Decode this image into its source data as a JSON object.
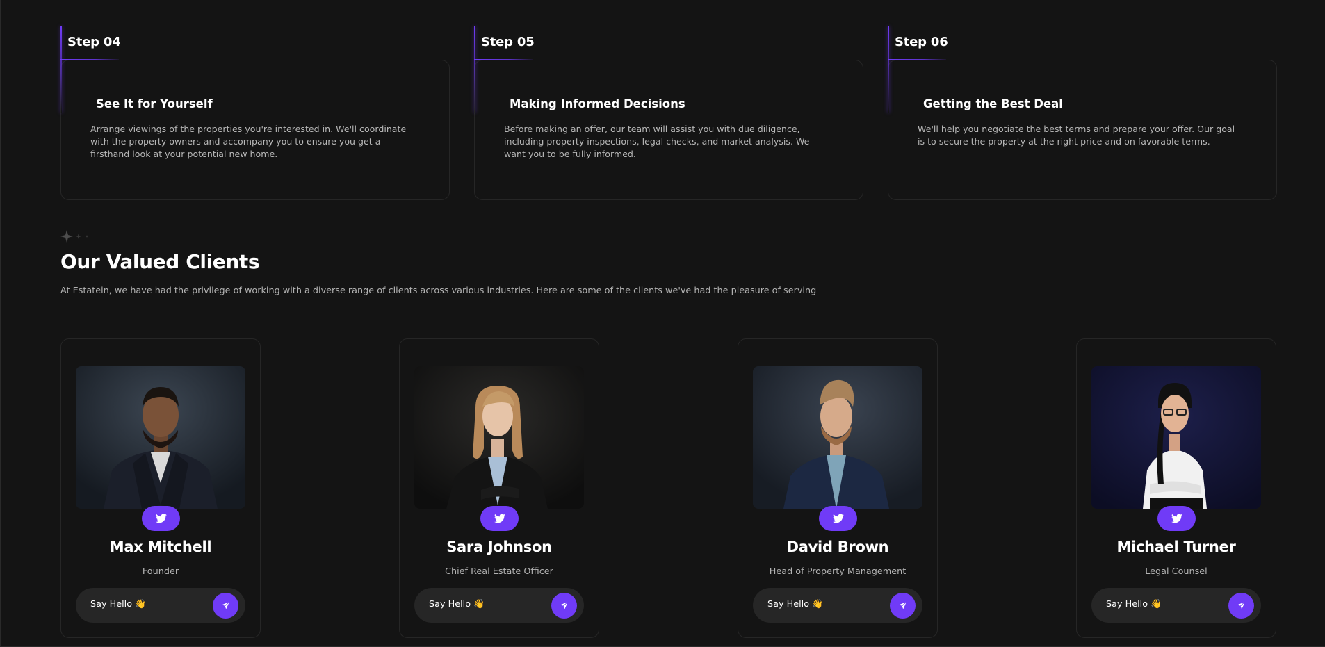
{
  "steps": [
    {
      "label": "Step 04",
      "title": "See It for Yourself",
      "description": "Arrange viewings of the properties you're interested in. We'll coordinate with the property owners and accompany you to ensure you get a firsthand look at your potential new home."
    },
    {
      "label": "Step 05",
      "title": "Making Informed Decisions",
      "description": "Before making an offer, our team will assist you with due diligence, including property inspections, legal checks, and market analysis. We want you to be fully informed."
    },
    {
      "label": "Step 06",
      "title": "Getting the Best Deal",
      "description": "We'll help you negotiate the best terms and prepare your offer. Our goal is to secure the property at the right price and on favorable terms."
    }
  ],
  "clients_section": {
    "sparkle_icon": "sparkle-icon",
    "title": "Our Valued Clients",
    "description": "At Estatein, we have had the privilege of working with a diverse range of clients across various industries. Here are some of the clients we've had the pleasure of serving"
  },
  "clients": [
    {
      "name": "Max Mitchell",
      "role": "Founder",
      "hello_label": "Say Hello 👋",
      "social_icon": "twitter-icon",
      "send_icon": "send-icon"
    },
    {
      "name": "Sara Johnson",
      "role": "Chief Real Estate Officer",
      "hello_label": "Say Hello 👋",
      "social_icon": "twitter-icon",
      "send_icon": "send-icon"
    },
    {
      "name": "David Brown",
      "role": "Head of Property Management",
      "hello_label": "Say Hello 👋",
      "social_icon": "twitter-icon",
      "send_icon": "send-icon"
    },
    {
      "name": "Michael Turner",
      "role": "Legal Counsel",
      "hello_label": "Say Hello 👋",
      "social_icon": "twitter-icon",
      "send_icon": "send-icon"
    }
  ],
  "colors": {
    "background": "#141414",
    "accent": "#703BF7",
    "card_border": "#262626",
    "muted_text": "#B3B3B3"
  }
}
